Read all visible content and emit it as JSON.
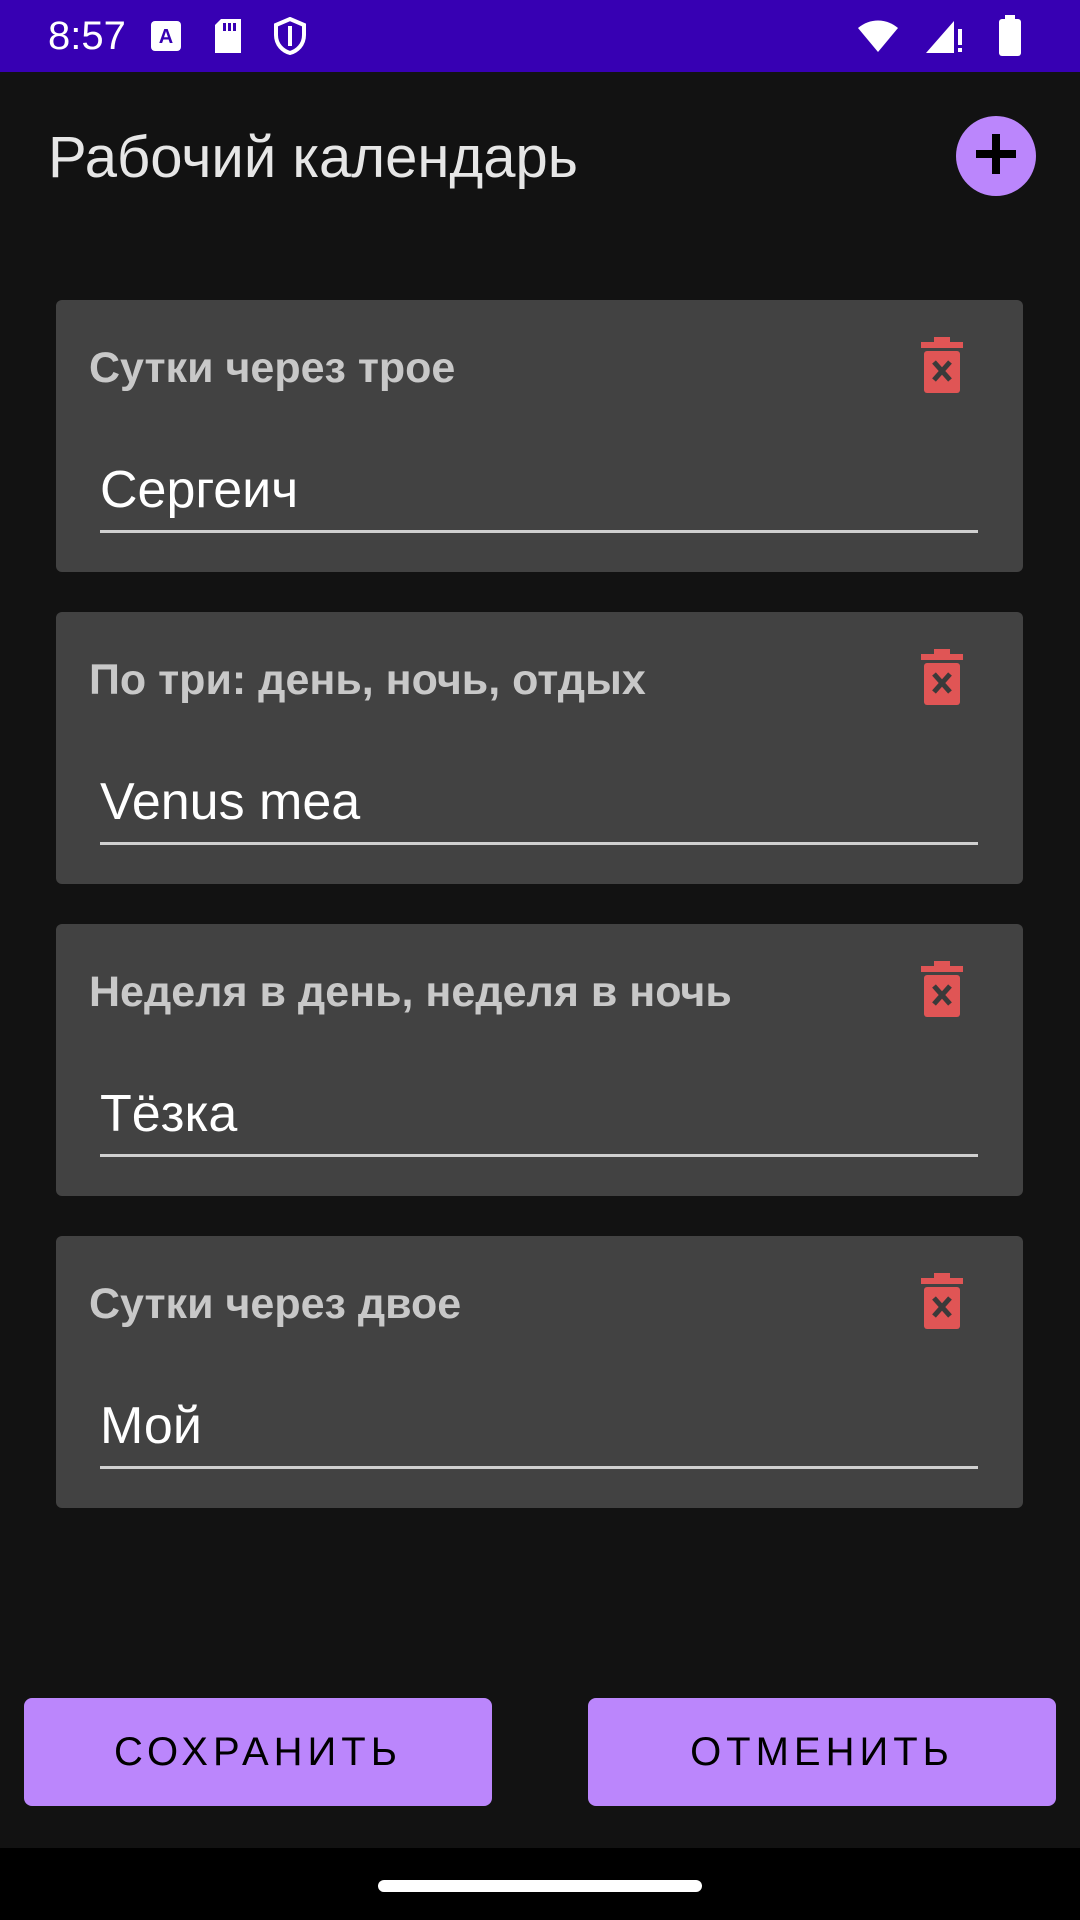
{
  "status_bar": {
    "time": "8:57",
    "left_icons": [
      "a-keyboard-icon",
      "sd-card-icon",
      "shield-icon"
    ],
    "right_icons": [
      "wifi-icon",
      "signal-icon",
      "battery-icon"
    ],
    "background": "#3700b3"
  },
  "header": {
    "title": "Рабочий календарь",
    "add_icon": "plus-icon"
  },
  "cards": [
    {
      "title": "Сутки через трое",
      "value": "Сергеич"
    },
    {
      "title": "По три: день, ночь, отдых",
      "value": "Venus mea"
    },
    {
      "title": "Неделя в день, неделя в ночь",
      "value": "Тёзка"
    },
    {
      "title": "Сутки через двое",
      "value": "Мой"
    }
  ],
  "actions": {
    "save_label": "СОХРАНИТЬ",
    "cancel_label": "ОТМЕНИТЬ"
  },
  "colors": {
    "accent": "#bb86fc",
    "delete": "#e05555",
    "card": "#424242",
    "background": "#121212"
  }
}
